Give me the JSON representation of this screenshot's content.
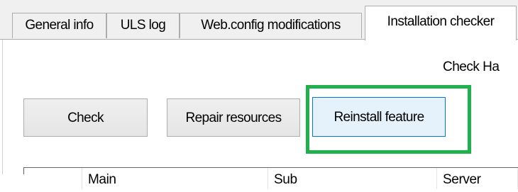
{
  "tabs": [
    {
      "label": "General info",
      "active": false
    },
    {
      "label": "ULS log",
      "active": false
    },
    {
      "label": "Web.config modifications",
      "active": false
    },
    {
      "label": "Installation checker",
      "active": true
    }
  ],
  "panel": {
    "header_text": "Check Ha"
  },
  "buttons": {
    "check": "Check",
    "repair_resources": "Repair resources",
    "reinstall_feature": "Reinstall feature"
  },
  "grid": {
    "columns": [
      "",
      "Main",
      "Sub",
      "Server"
    ]
  },
  "colors": {
    "highlight_border": "#1fb14b",
    "hover_button_bg": "#e5f1fb",
    "hover_button_border": "#0078d7"
  }
}
